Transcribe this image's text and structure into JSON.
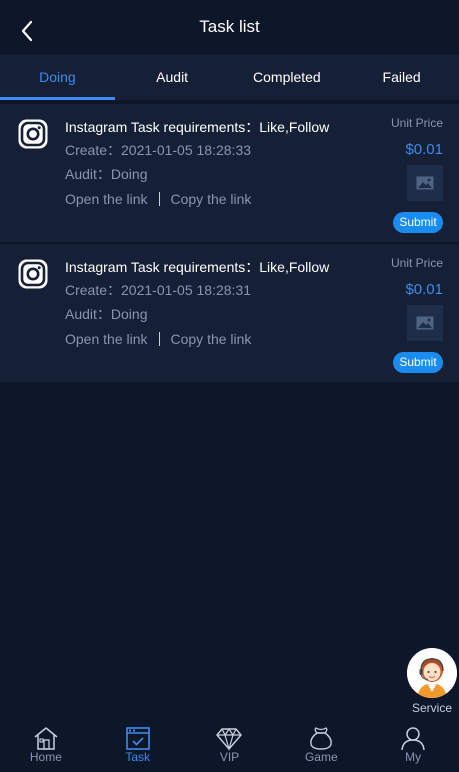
{
  "header": {
    "title": "Task list"
  },
  "tabs": [
    {
      "label": "Doing",
      "active": true
    },
    {
      "label": "Audit",
      "active": false
    },
    {
      "label": "Completed",
      "active": false
    },
    {
      "label": "Failed",
      "active": false
    }
  ],
  "tasks": [
    {
      "icon": "instagram-icon",
      "title": "Instagram Task requirements：Like,Follow",
      "create": "Create：2021-01-05 18:28:33",
      "audit": "Audit：Doing",
      "open_link": "Open the link",
      "copy_link": "Copy the link",
      "price_label": "Unit Price",
      "price": "$0.01",
      "submit": "Submit"
    },
    {
      "icon": "instagram-icon",
      "title": "Instagram Task requirements：Like,Follow",
      "create": "Create：2021-01-05 18:28:31",
      "audit": "Audit：Doing",
      "open_link": "Open the link",
      "copy_link": "Copy the link",
      "price_label": "Unit Price",
      "price": "$0.01",
      "submit": "Submit"
    }
  ],
  "service": {
    "label": "Service"
  },
  "bottom_nav": [
    {
      "label": "Home",
      "icon": "home-icon",
      "active": false
    },
    {
      "label": "Task",
      "icon": "task-icon",
      "active": true
    },
    {
      "label": "VIP",
      "icon": "diamond-icon",
      "active": false
    },
    {
      "label": "Game",
      "icon": "game-bag-icon",
      "active": false
    },
    {
      "label": "My",
      "icon": "user-icon",
      "active": false
    }
  ],
  "colors": {
    "background": "#0e1629",
    "card": "#151f35",
    "accent": "#3d8bf0",
    "muted_text": "#8a95b0",
    "submit_button": "#1a8cf0"
  }
}
